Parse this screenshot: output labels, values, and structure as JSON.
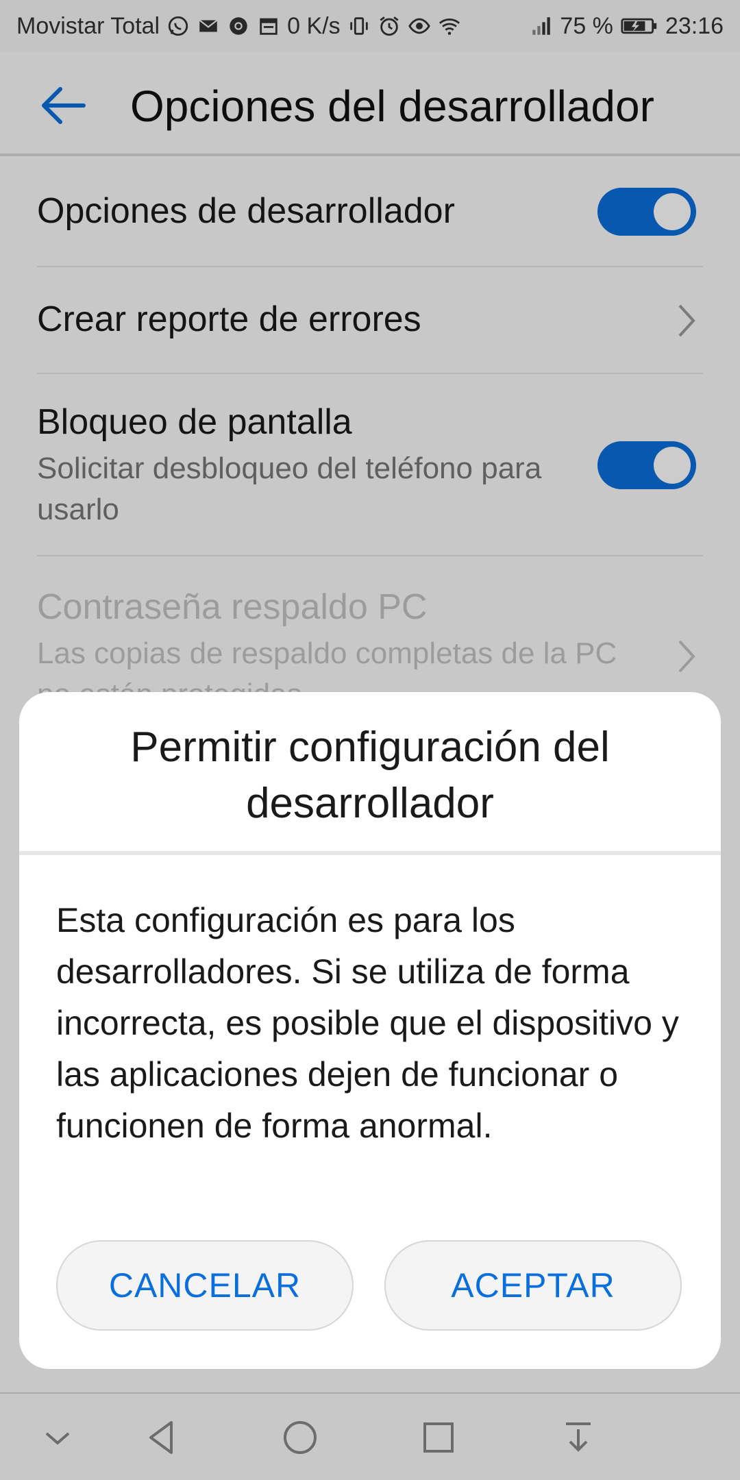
{
  "status_bar": {
    "carrier": "Movistar Total",
    "speed": "0 K/s",
    "battery_pct": "75 %",
    "time": "23:16",
    "icons": [
      "whatsapp-icon",
      "mail-icon",
      "chrome-icon",
      "calendar-icon",
      "vibrate-icon",
      "alarm-icon",
      "eye-icon",
      "wifi-icon",
      "signal-icon",
      "battery-icon"
    ]
  },
  "toolbar": {
    "back_icon": "arrow-left-icon",
    "title": "Opciones del desarrollador"
  },
  "settings": {
    "developer_options": {
      "title": "Opciones de desarrollador",
      "enabled": true
    },
    "bug_report": {
      "title": "Crear reporte de errores"
    },
    "screen_lock": {
      "title": "Bloqueo de pantalla",
      "subtitle": "Solicitar desbloqueo del teléfono para usarlo",
      "enabled": true
    },
    "backup_password": {
      "title": "Contraseña respaldo PC",
      "subtitle": "Las copias de respaldo completas de la PC no están protegidas"
    }
  },
  "dialog": {
    "title": "Permitir configuración del desarrollador",
    "body": "Esta configuración es para los desarrolladores. Si se utiliza de forma incorrecta, es posible que el dispositivo y las aplicaciones dejen de funcionar o funcionen de forma anormal.",
    "cancel_label": "CANCELAR",
    "accept_label": "ACEPTAR"
  },
  "nav_bar": {
    "icons": [
      "chevron-down-icon",
      "back-triangle-icon",
      "home-circle-icon",
      "recents-square-icon",
      "notification-pull-icon"
    ]
  },
  "colors": {
    "accent": "#0a6fdc",
    "scrim": "rgba(0,0,0,0.2)"
  }
}
